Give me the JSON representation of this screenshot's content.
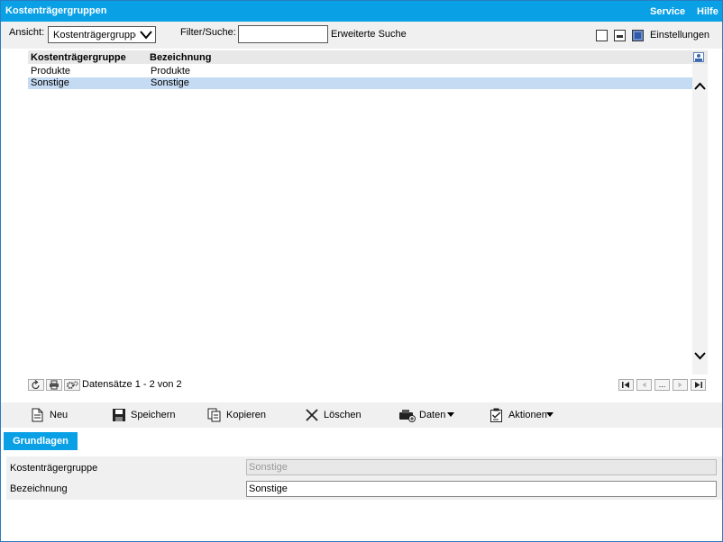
{
  "header": {
    "title": "Kostenträgergruppen",
    "menu": [
      {
        "label": "Service"
      },
      {
        "label": "Hilfe"
      }
    ]
  },
  "toolbar": {
    "view_label": "Ansicht:",
    "view_value": "Kostenträgergruppe",
    "filter_label": "Filter/Suche:",
    "filter_value": "",
    "advanced_search": "Erweiterte Suche",
    "settings_label": "Einstellungen"
  },
  "grid": {
    "columns": [
      "Kostenträgergruppe",
      "Bezeichnung"
    ],
    "rows": [
      {
        "group": "Produkte",
        "name": "Produkte",
        "selected": false
      },
      {
        "group": "Sonstige",
        "name": "Sonstige",
        "selected": true
      }
    ]
  },
  "pager": {
    "record_text": "Datensätze 1 - 2 von 2",
    "more_label": "..."
  },
  "actions": {
    "new": "Neu",
    "save": "Speichern",
    "copy": "Kopieren",
    "delete": "Löschen",
    "data": "Daten",
    "actions": "Aktionen"
  },
  "tabs": [
    {
      "label": "Grundlagen"
    }
  ],
  "form": {
    "group_label": "Kostenträgergruppe",
    "group_value": "Sonstige",
    "name_label": "Bezeichnung",
    "name_value": "Sonstige"
  },
  "colors": {
    "accent": "#0aa0e6",
    "selected_row": "#c5daf3"
  }
}
